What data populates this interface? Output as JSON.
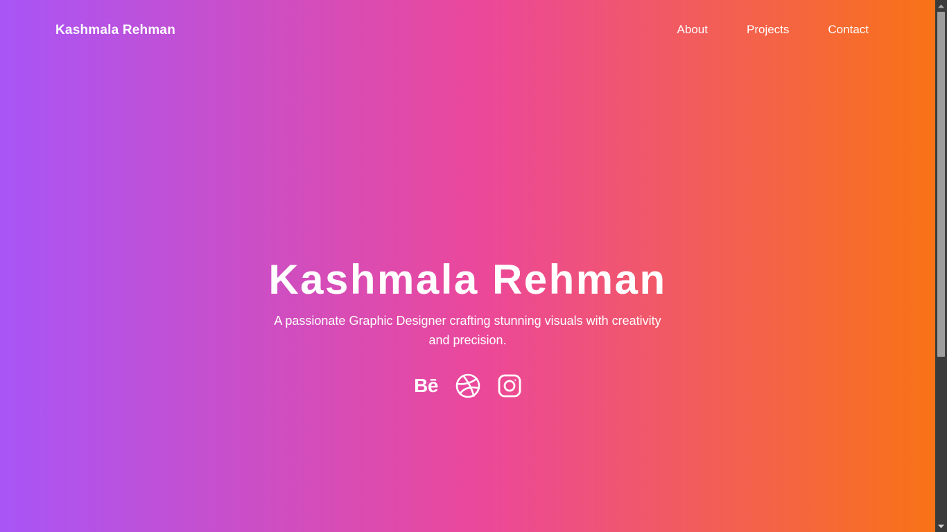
{
  "navbar": {
    "brand": "Kashmala Rehman",
    "links": [
      {
        "label": "About"
      },
      {
        "label": "Projects"
      },
      {
        "label": "Contact"
      }
    ]
  },
  "hero": {
    "title": "Kashmala Rehman",
    "subtitle": "A passionate Graphic Designer crafting stunning visuals with creativity and precision."
  },
  "socials": [
    {
      "name": "behance",
      "glyph": "Bē",
      "icon": "behance-icon"
    },
    {
      "name": "dribbble",
      "icon": "dribbble-icon"
    },
    {
      "name": "instagram",
      "icon": "instagram-icon"
    }
  ],
  "theme": {
    "gradient_start": "#a855f7",
    "gradient_mid": "#ec4899",
    "gradient_end": "#f97316",
    "text": "#ffffff",
    "scrollbar_track": "#3b3b3b",
    "scrollbar_thumb": "#9e9e9e"
  }
}
